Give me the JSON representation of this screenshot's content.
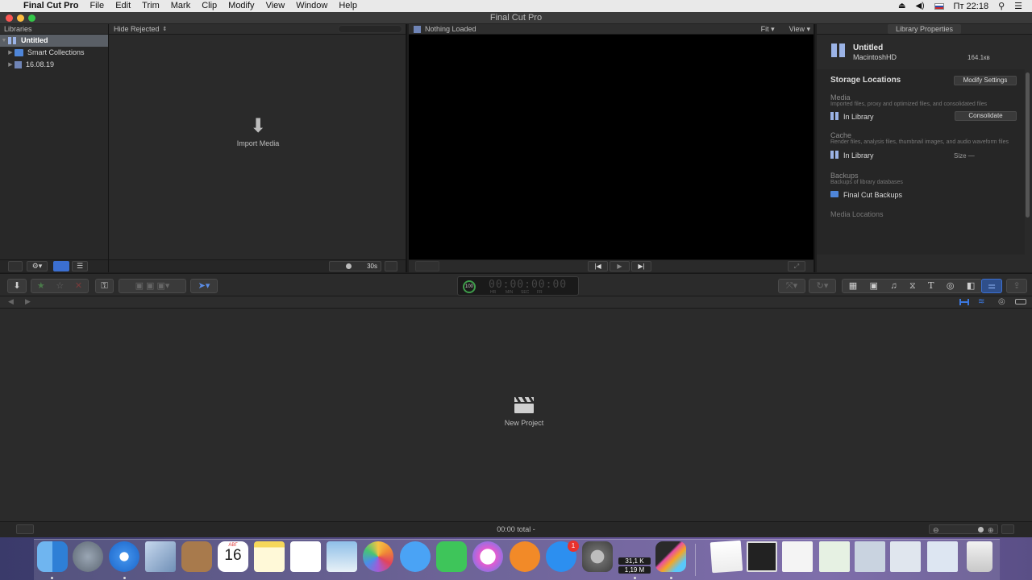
{
  "menubar": {
    "app_name": "Final Cut Pro",
    "items": [
      "File",
      "Edit",
      "Trim",
      "Mark",
      "Clip",
      "Modify",
      "View",
      "Window",
      "Help"
    ],
    "clock": "Пт 22:18"
  },
  "window": {
    "title": "Final Cut Pro"
  },
  "libraries": {
    "header": "Libraries",
    "items": [
      {
        "label": "Untitled"
      },
      {
        "label": "Smart Collections"
      },
      {
        "label": "16.08.19"
      }
    ]
  },
  "browser": {
    "filter_label": "Hide Rejected",
    "empty_label": "Import Media",
    "clip_duration": "30s"
  },
  "viewer": {
    "status": "Nothing Loaded",
    "zoom": "Fit",
    "view_menu": "View"
  },
  "inspector": {
    "header": "Library Properties",
    "library_name": "Untitled",
    "volume": "MacintoshHD",
    "size": "164.1кв",
    "storage_title": "Storage Locations",
    "modify_button": "Modify Settings",
    "media_title": "Media",
    "media_desc": "Imported files, proxy and optimized files, and consolidated files",
    "media_location": "In Library",
    "consolidate_button": "Consolidate",
    "cache_title": "Cache",
    "cache_desc": "Render files, analysis files, thumbnail images, and audio waveform files",
    "cache_location": "In Library",
    "cache_size": "Size —",
    "backups_title": "Backups",
    "backups_desc": "Backups of library databases",
    "backups_location": "Final Cut Backups",
    "media_locations_title": "Media Locations"
  },
  "timecode": {
    "percent": "100",
    "display": "00:00:00:00",
    "units": [
      "HR",
      "MIN",
      "SEC",
      "FR"
    ]
  },
  "timeline": {
    "empty_label": "New Project",
    "total": "00:00 total -"
  },
  "dock": {
    "calendar_month": "АВГ",
    "calendar_day": "16",
    "appstore_badge": "1",
    "net_up": "31,1 K",
    "net_down": "1,19 M"
  },
  "colors": {
    "accent_blue": "#3a7bd5",
    "selection": "#5a5f66",
    "dock_purple": "#5a4f8a"
  }
}
